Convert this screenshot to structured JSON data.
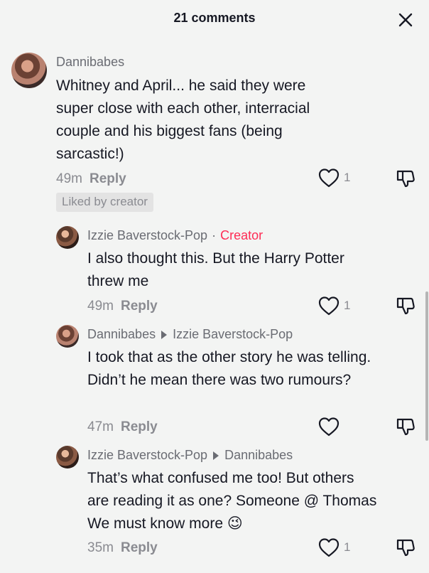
{
  "header": {
    "title": "21 comments"
  },
  "comments": [
    {
      "username": "Dannibabes",
      "text": "Whitney and April... he said they were super close with each other, interracial couple and his biggest fans (being sarcastic!)",
      "time": "49m",
      "reply_label": "Reply",
      "like_count": "1",
      "badge": "Liked by creator"
    },
    {
      "username": "Izzie Baverstock-Pop",
      "creator_label": "Creator",
      "text": "I also thought this. But the Harry Potter threw me",
      "time": "49m",
      "reply_label": "Reply",
      "like_count": "1"
    },
    {
      "username": "Dannibabes",
      "reply_to": "Izzie Baverstock-Pop",
      "text": "I took that as the other story he was telling. Didn’t he mean there was two rumours?",
      "time": "47m",
      "reply_label": "Reply"
    },
    {
      "username": "Izzie Baverstock-Pop",
      "reply_to": "Dannibabes",
      "text": "That’s what confused me too! But others are reading it as one? Someone @ Thomas We must know more",
      "emoji": "😉",
      "time": "35m",
      "reply_label": "Reply",
      "like_count": "1"
    }
  ],
  "icons": {
    "close": "close-icon",
    "like": "heart-outline-icon",
    "dislike": "thumbs-down-icon",
    "reply_arrow": "triangle-right-icon"
  },
  "colors": {
    "background": "#f3f4f3",
    "text": "#161823",
    "muted": "#8a8b91",
    "creator": "#fe2c55"
  }
}
